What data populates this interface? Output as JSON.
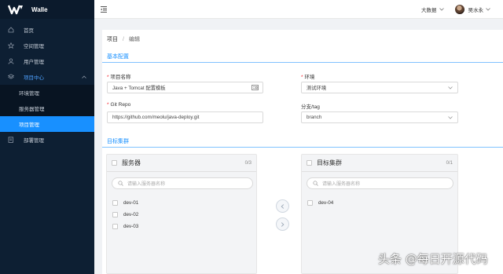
{
  "app": {
    "name": "Walle"
  },
  "sidebar": {
    "items": [
      {
        "label": "首页",
        "icon": "home-icon"
      },
      {
        "label": "空间管理",
        "icon": "star-icon"
      },
      {
        "label": "用户管理",
        "icon": "user-icon"
      },
      {
        "label": "项目中心",
        "icon": "layers-icon"
      }
    ],
    "submenu": [
      {
        "label": "环境管理"
      },
      {
        "label": "服务器管理"
      },
      {
        "label": "项目管理"
      }
    ],
    "last_item": {
      "label": "部署管理",
      "icon": "deploy-icon"
    }
  },
  "header": {
    "space": "大数据",
    "user": "吴水永"
  },
  "breadcrumb": {
    "root": "项目",
    "separator": "/",
    "current": "编辑"
  },
  "sections": {
    "basic": "基本配置",
    "targets": "目标集群"
  },
  "form": {
    "project_name": {
      "label": "项目名称",
      "value": "Java + Tomcat 配置模板"
    },
    "environment": {
      "label": "环境",
      "value": "测试环境"
    },
    "git_repo": {
      "label": "Git Repo",
      "value": "https://github.com/meolu/java-deploy.git"
    },
    "branch": {
      "label": "分支/tag",
      "value": "branch"
    }
  },
  "transfer": {
    "left": {
      "title": "服务器",
      "count": "0/3",
      "placeholder": "请输入服务器名称",
      "items": [
        "dev-01",
        "dev-02",
        "dev-03"
      ]
    },
    "right": {
      "title": "目标集群",
      "count": "0/1",
      "placeholder": "请输入服务器名称",
      "items": [
        "dev-04"
      ]
    }
  },
  "watermark": "头条 @每日开源代码",
  "colors": {
    "sidebar_bg": "#0d1f33",
    "accent": "#1890ff",
    "required": "#f5222d"
  }
}
